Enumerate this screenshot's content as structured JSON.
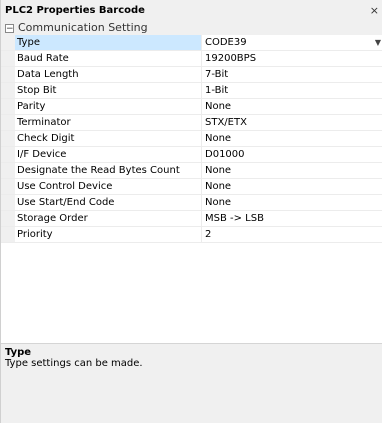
{
  "window": {
    "title": "PLC2 Properties Barcode",
    "close_glyph": "×"
  },
  "category": {
    "toggle_glyph": "⊟",
    "label": "Communication Setting"
  },
  "properties": [
    {
      "name": "Type",
      "value": "CODE39"
    },
    {
      "name": "Baud Rate",
      "value": "19200BPS"
    },
    {
      "name": "Data Length",
      "value": "7-Bit"
    },
    {
      "name": "Stop Bit",
      "value": "1-Bit"
    },
    {
      "name": "Parity",
      "value": "None"
    },
    {
      "name": "Terminator",
      "value": "STX/ETX"
    },
    {
      "name": "Check Digit",
      "value": "None"
    },
    {
      "name": "I/F Device",
      "value": "D01000"
    },
    {
      "name": "Designate the Read Bytes Count",
      "value": " None"
    },
    {
      "name": "Use Control Device",
      "value": " None"
    },
    {
      "name": "Use Start/End Code",
      "value": " None"
    },
    {
      "name": "Storage Order",
      "value": "MSB -> LSB"
    },
    {
      "name": "Priority",
      "value": "2"
    }
  ],
  "dropdown_glyph": "▼",
  "description": {
    "title": "Type",
    "text": "Type settings can be made."
  }
}
